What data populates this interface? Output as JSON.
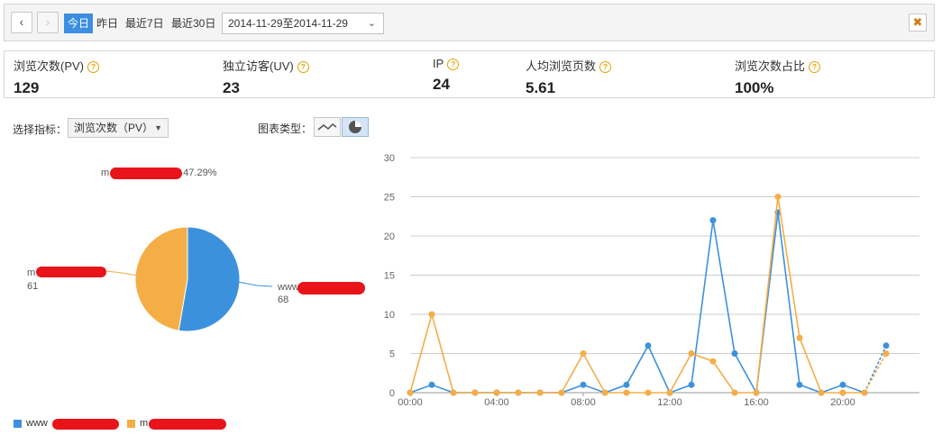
{
  "toolbar": {
    "prev_icon": "chevron-left-icon",
    "next_icon": "chevron-right-icon",
    "periods": [
      "今日",
      "昨日",
      "最近7日",
      "最近30日"
    ],
    "active_period": 0,
    "date_range": "2014-11-29至2014-11-29",
    "pin_icon": "pin-icon"
  },
  "metrics": [
    {
      "label": "浏览次数(PV)",
      "value": "129"
    },
    {
      "label": "独立访客(UV)",
      "value": "23"
    },
    {
      "label": "IP",
      "value": "24"
    },
    {
      "label": "人均浏览页数",
      "value": "5.61"
    },
    {
      "label": "浏览次数占比",
      "value": "100%"
    }
  ],
  "options": {
    "metric_label": "选择指标：",
    "metric_value": "浏览次数（PV）",
    "chart_type_label": "图表类型："
  },
  "colors": {
    "series_a": "#3c91dd",
    "series_b": "#f5ad46",
    "accent": "#3c8fe0"
  },
  "pie": {
    "top_label": "47.29%",
    "left_label_value": "61",
    "right_label_prefix": "www",
    "right_label_value": "68",
    "left_label_prefix": "m"
  },
  "legend": {
    "item_a_prefix": "www",
    "item_b_prefix": "m"
  },
  "chart_data": [
    {
      "type": "pie",
      "slices": [
        {
          "label": "www[redacted]",
          "value": 68,
          "color": "#3c91dd"
        },
        {
          "label": "m[redacted]",
          "value": 61,
          "color": "#f5ad46"
        }
      ]
    },
    {
      "type": "line",
      "x": [
        "00:00",
        "01:00",
        "02:00",
        "03:00",
        "04:00",
        "05:00",
        "06:00",
        "07:00",
        "08:00",
        "09:00",
        "10:00",
        "11:00",
        "12:00",
        "13:00",
        "14:00",
        "15:00",
        "16:00",
        "17:00",
        "18:00",
        "19:00",
        "20:00",
        "21:00",
        "22:00"
      ],
      "xticks": [
        "00:00",
        "04:00",
        "08:00",
        "12:00",
        "16:00",
        "20:00"
      ],
      "ylim": [
        0,
        30
      ],
      "yticks": [
        0,
        5,
        10,
        15,
        20,
        25,
        30
      ],
      "grid": true,
      "series": [
        {
          "color": "#3c91dd",
          "values": [
            0,
            1,
            0,
            0,
            0,
            0,
            0,
            0,
            1,
            0,
            1,
            6,
            0,
            1,
            22,
            5,
            0,
            23,
            1,
            0,
            1,
            0,
            6
          ]
        },
        {
          "color": "#f5ad46",
          "values": [
            0,
            10,
            0,
            0,
            0,
            0,
            0,
            0,
            5,
            0,
            0,
            0,
            0,
            5,
            4,
            0,
            0,
            25,
            7,
            0,
            0,
            0,
            5
          ]
        }
      ]
    }
  ]
}
